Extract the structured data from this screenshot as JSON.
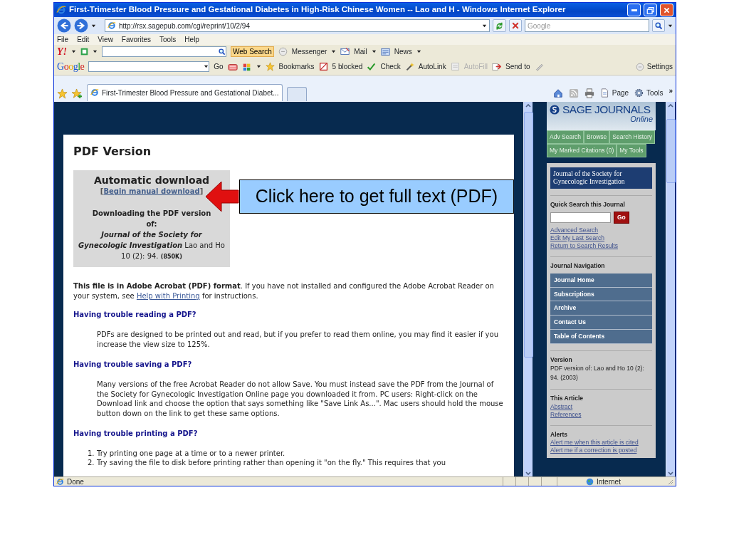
{
  "window": {
    "title": "First-Trimester Blood Pressure and Gestational Diabetes in High-Risk Chinese Women -- Lao and H - Windows Internet Explorer"
  },
  "address_bar": {
    "url": "http://rsx.sagepub.com/cgi/reprint/10/2/94"
  },
  "search_box": {
    "placeholder": "Google"
  },
  "menu_bar": [
    "File",
    "Edit",
    "View",
    "Favorites",
    "Tools",
    "Help"
  ],
  "yahoo_toolbar": {
    "logo": "Y!",
    "search_button": "Web Search",
    "items": [
      {
        "label": "Messenger"
      },
      {
        "label": "Mail"
      },
      {
        "label": "News"
      }
    ]
  },
  "google_toolbar": {
    "logo": "Google",
    "go": "Go",
    "settings": "Settings",
    "items": [
      {
        "label": "Bookmarks",
        "disabled": false
      },
      {
        "label": "5 blocked",
        "disabled": false
      },
      {
        "label": "Check",
        "disabled": false
      },
      {
        "label": "AutoLink",
        "disabled": false
      },
      {
        "label": "AutoFill",
        "disabled": true
      },
      {
        "label": "Send to",
        "disabled": false
      }
    ]
  },
  "tabs": [
    {
      "label": "First-Trimester Blood Pressure and Gestational Diabet...",
      "selected": true
    }
  ],
  "command_bar": [
    {
      "label": "Page"
    },
    {
      "label": "Tools"
    }
  ],
  "command_more": "»",
  "page": {
    "heading": "PDF Version",
    "download_box": {
      "title": "Automatic download",
      "bracket_open": "[",
      "link": "Begin manual download",
      "bracket_close": "]",
      "downloading": "Downloading the PDF version of:",
      "citation": "**Journal of the Society for Gynecologic Investigation** Lao and Ho 10 (2): 94. **(850K)**"
    },
    "intro": {
      "before": "**This file is in Adobe Acrobat (PDF) format**. If you have not installed and configured the Adobe Acrobat Reader on your system, see ",
      "link": "Help with Printing",
      "after": " for instructions."
    },
    "sections": [
      {
        "heading": "Having trouble reading a PDF?",
        "kind": "paragraph",
        "body": "PDFs are designed to be printed out and read, but if you prefer to read them online, you may find it easier if you increase the view size to 125%."
      },
      {
        "heading": "Having trouble saving a PDF?",
        "kind": "paragraph",
        "body": "Many versions of the free Acrobat Reader do not allow Save. You must instead save the PDF from the Journal of the Society for Gynecologic Investigation Online page you downloaded it from. PC users: Right-click on the Download link and choose the option that says something like \"Save Link As...\". Mac users should hold the mouse button down on the link to get these same options."
      },
      {
        "heading": "Having trouble printing a PDF?",
        "kind": "list",
        "items": [
          {
            "number": "1.",
            "text": "Try printing one page at a time or to a newer printer."
          },
          {
            "number": "2.",
            "text": "Try saving the file to disk before printing rather than opening it \"on the fly.\" This requires that you"
          }
        ]
      }
    ]
  },
  "callout": {
    "text": "Click here to get full text (PDF)"
  },
  "sidebar": {
    "logo": "SAGE JOURNALS",
    "logo_sub": "Online",
    "tabs": [
      [
        "Adv Search",
        "Browse",
        "Search History"
      ],
      [
        "My Marked Citations (0)",
        "My Tools"
      ]
    ],
    "journal": "Journal of the Society for Gynecologic Investigation",
    "quick_search": {
      "heading": "Quick Search this Journal",
      "go": "Go",
      "links": [
        "Advanced Search",
        "Edit My Last Search",
        "Return to Search Results"
      ]
    },
    "navigation": {
      "heading": "Journal Navigation",
      "items": [
        "Journal Home",
        "Subscriptions",
        "Archive",
        "Contact Us",
        "Table of Contents"
      ]
    },
    "version": {
      "heading": "Version",
      "text": "PDF version of: Lao and Ho 10 (2): 94. (2003)"
    },
    "article": {
      "heading": "This Article",
      "links": [
        "Abstract",
        "References"
      ]
    },
    "alerts": {
      "heading": "Alerts",
      "links": [
        "Alert me when this article is cited",
        "Alert me if a correction is posted"
      ]
    }
  },
  "status_bar": {
    "text": "Done",
    "zone": "Internet"
  }
}
